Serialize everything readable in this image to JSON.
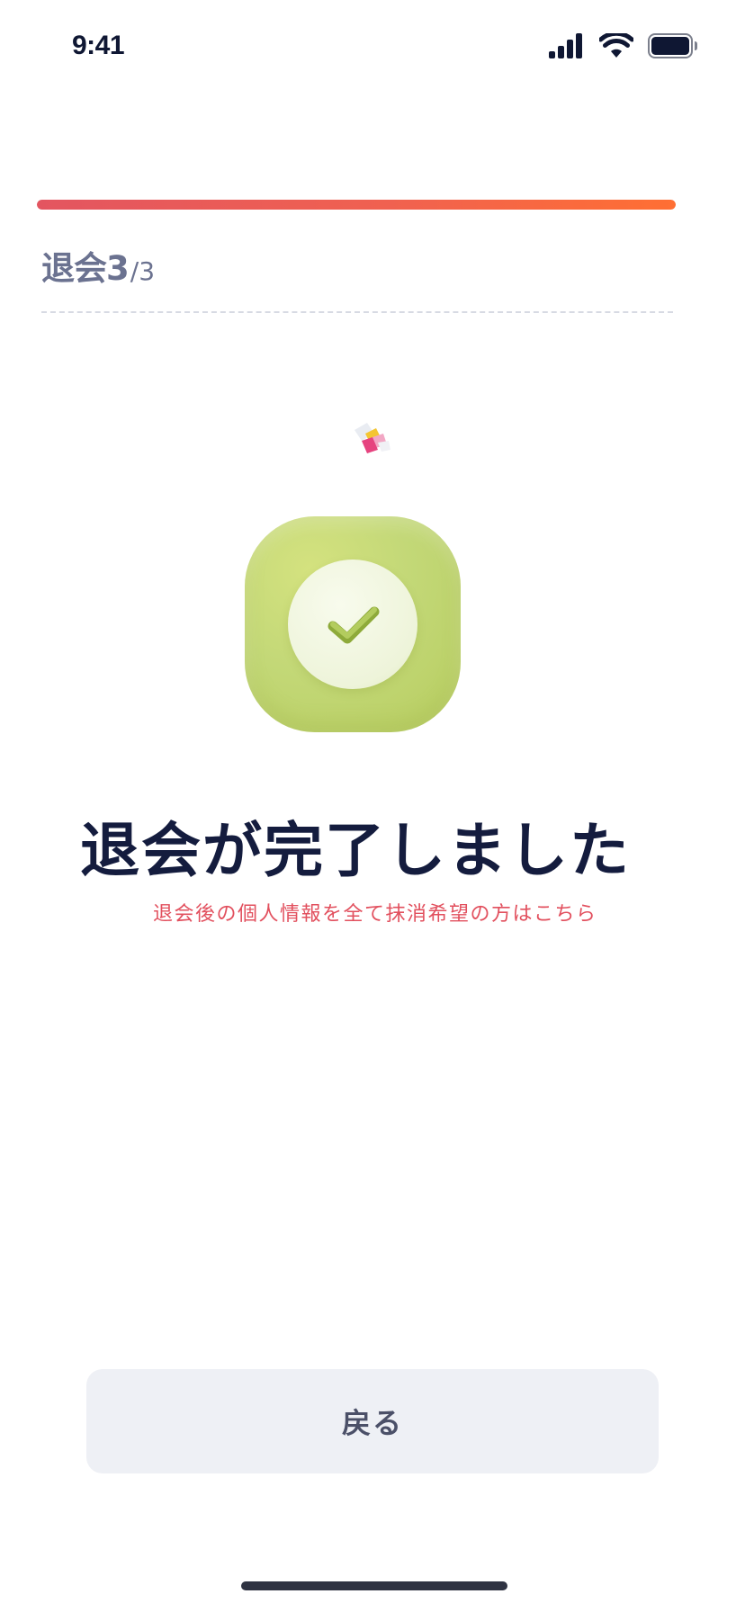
{
  "status_bar": {
    "time": "9:41",
    "icons": [
      "signal-icon",
      "wifi-icon",
      "battery-icon"
    ]
  },
  "progress": {
    "step_label": "退会3",
    "step_separator": "/",
    "step_total": "3",
    "fraction": 1.0,
    "gradient_start": "#e35560",
    "gradient_end": "#ff6f33"
  },
  "illustration": {
    "confetti": "confetti-icon",
    "badge": "checkmark-badge-icon",
    "badge_color": "#c3d877"
  },
  "content": {
    "title": "退会が完了しました",
    "delete_info_link": "退会後の個人情報を全て抹消希望の方はこちら",
    "link_color": "#e2505e"
  },
  "footer": {
    "back_button_label": "戻る"
  }
}
